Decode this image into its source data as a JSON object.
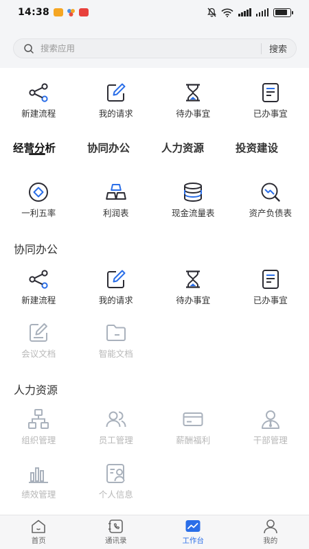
{
  "status_bar": {
    "time": "14:38"
  },
  "search": {
    "placeholder": "搜索应用",
    "button_label": "搜索"
  },
  "quick_actions": [
    {
      "label": "新建流程",
      "icon": "share-icon"
    },
    {
      "label": "我的请求",
      "icon": "edit-icon"
    },
    {
      "label": "待办事宜",
      "icon": "hourglass-icon"
    },
    {
      "label": "已办事宜",
      "icon": "document-icon"
    }
  ],
  "tabs": [
    {
      "label": "经营分析",
      "active": true
    },
    {
      "label": "协同办公",
      "active": false
    },
    {
      "label": "人力资源",
      "active": false
    },
    {
      "label": "投资建设",
      "active": false
    }
  ],
  "analysis_items": [
    {
      "label": "一利五率",
      "icon": "diamond-icon"
    },
    {
      "label": "利润表",
      "icon": "gold-bars-icon"
    },
    {
      "label": "现金流量表",
      "icon": "coin-stack-icon"
    },
    {
      "label": "资产负债表",
      "icon": "chart-magnifier-icon"
    }
  ],
  "sections": {
    "collab": {
      "title": "协同办公",
      "items": [
        {
          "label": "新建流程",
          "icon": "share-icon"
        },
        {
          "label": "我的请求",
          "icon": "edit-icon"
        },
        {
          "label": "待办事宜",
          "icon": "hourglass-icon"
        },
        {
          "label": "已办事宜",
          "icon": "document-icon"
        },
        {
          "label": "会议文档",
          "icon": "meeting-doc-icon"
        },
        {
          "label": "智能文档",
          "icon": "folder-icon"
        }
      ]
    },
    "hr": {
      "title": "人力资源",
      "items": [
        {
          "label": "组织管理",
          "icon": "org-chart-icon"
        },
        {
          "label": "员工管理",
          "icon": "staff-icon"
        },
        {
          "label": "薪酬福利",
          "icon": "card-icon"
        },
        {
          "label": "干部管理",
          "icon": "cadre-icon"
        },
        {
          "label": "绩效管理",
          "icon": "bar-chart-icon"
        },
        {
          "label": "个人信息",
          "icon": "id-card-icon"
        }
      ]
    }
  },
  "bottom_nav": [
    {
      "label": "首页",
      "icon": "home-icon",
      "active": false
    },
    {
      "label": "通讯录",
      "icon": "contacts-icon",
      "active": false
    },
    {
      "label": "工作台",
      "icon": "workbench-icon",
      "active": true
    },
    {
      "label": "我的",
      "icon": "profile-icon",
      "active": false
    }
  ],
  "colors": {
    "accent": "#2a6ee8",
    "icon_dark": "#2b2b33",
    "icon_disabled": "#a9b1bc",
    "header_bg": "#f4f5f7"
  }
}
